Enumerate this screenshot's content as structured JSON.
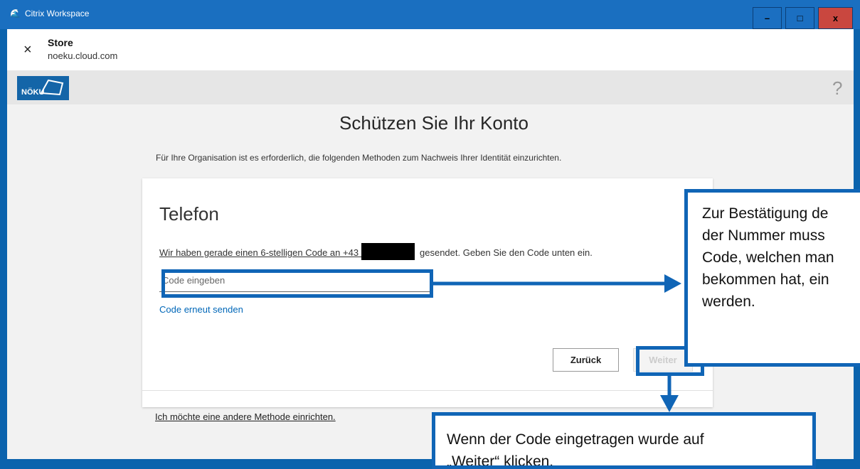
{
  "window": {
    "title": "Citrix Workspace",
    "minimize": "–",
    "maximize": "□",
    "close": "x"
  },
  "storebar": {
    "close": "×",
    "store": "Store",
    "domain": "noeku.cloud.com"
  },
  "brand": {
    "logo_text": "NÖKU",
    "help": "?"
  },
  "page": {
    "heading": "Schützen Sie Ihr Konto",
    "subtext": "Für Ihre Organisation ist es erforderlich, die folgenden Methoden zum Nachweis Ihrer Identität einzurichten."
  },
  "card": {
    "title": "Telefon",
    "info_prefix": "Wir haben gerade einen 6-stelligen Code an +43 664",
    "info_suffix": "gesendet. Geben Sie den Code unten ein.",
    "code_placeholder": "Code eingeben",
    "resend": "Code erneut senden",
    "back": "Zurück",
    "next": "Weiter",
    "alt_method": "Ich möchte eine andere Methode einrichten."
  },
  "annotations": {
    "callout_right": "Zur Bestätigung de\nder Nummer muss\nCode, welchen man\nbekommen hat, ein\nwerden.",
    "callout_bottom": "Wenn der Code eingetragen wurde auf\n„Weiter“ klicken.",
    "accent_color": "#1065b6"
  }
}
